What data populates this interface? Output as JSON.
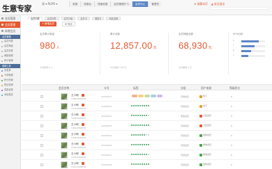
{
  "app": {
    "logo": "生意专家",
    "shop": "深 ▾ RLPO ▾"
  },
  "top_tabs": [
    {
      "label": "收银",
      "active": false
    },
    {
      "label": "收银台",
      "active": false
    },
    {
      "label": "快速收银",
      "active": false
    },
    {
      "label": "会员管理(F7)",
      "active": false
    },
    {
      "label": "会员中心",
      "active": true
    },
    {
      "label": "管理员",
      "active": false
    }
  ],
  "top_right": {
    "link1": "★ 收藏本页",
    "link2": "▲ 安全退出"
  },
  "sidebar": {
    "items": [
      {
        "label": "会员管理",
        "active": false
      },
      {
        "label": "会员管理",
        "active": true
      },
      {
        "label": "新增会员",
        "active": false
      }
    ],
    "sections": [
      {
        "title": "会员管理",
        "subs": [
          "会员列表",
          "会员等级",
          "会员标签",
          "储值管理",
          "积分管理"
        ]
      },
      {
        "title": "营销工具",
        "subs": [
          "优惠券",
          "卡项管理",
          "积分商城",
          "短信营销",
          "奖励设置",
          "消息推送"
        ]
      }
    ]
  },
  "subtabs": [
    {
      "label": "会员列表",
      "active": true
    },
    {
      "label": "会员标签",
      "active": false
    },
    {
      "label": "会员分组",
      "active": false
    },
    {
      "label": "会员卡",
      "active": false
    },
    {
      "label": "储值卡",
      "active": false
    },
    {
      "label": "商品设置",
      "active": false
    }
  ],
  "actions": {
    "add": "+ 新增会员",
    "filter": "▼ 筛选"
  },
  "stats": [
    {
      "label": "会员累计数量",
      "value": "980",
      "unit": "人",
      "sub": "今日新增 0 人"
    },
    {
      "label": "累计消费",
      "value": "12,857.00",
      "unit": "元",
      "sub": "今日消费 0.00 元"
    },
    {
      "label": "会员储值总额",
      "value": "68,930",
      "unit": "元",
      "sub": "今日储值 0 元"
    }
  ],
  "rfm": {
    "title": "RFM分析",
    "bars": [
      {
        "label": "R",
        "pct": 0.72
      },
      {
        "label": "F",
        "pct": 0.55
      },
      {
        "label": "M",
        "pct": 0.4
      },
      {
        "label": "V",
        "pct": 0.28
      }
    ]
  },
  "table": {
    "headers": [
      "会员名称",
      "卡号",
      "标签",
      "分组",
      "用户来源",
      "等级积分"
    ],
    "rows": [
      {
        "name": "王小明",
        "phone": "13812345678",
        "card": "00000001",
        "type": "tags",
        "group": "普通会员",
        "src": "线下",
        "src_color": "#e0a030",
        "pts": "0"
      },
      {
        "name": "王小明",
        "phone": "13712345678",
        "card": "00000002",
        "type": "stars",
        "stars": 5,
        "group": "普通会员",
        "src": "线下",
        "src_color": "#e0a030",
        "pts": "0"
      },
      {
        "name": "王小明",
        "phone": "13612345678",
        "card": "00000003",
        "type": "stars",
        "stars": 4,
        "group": "黄金会员",
        "src": "分店会员",
        "src_color": "#e5572f",
        "pts": "0"
      },
      {
        "name": "王小明",
        "phone": "13512345678",
        "card": "00000004",
        "type": "stars",
        "stars": 5,
        "group": "普通会员",
        "src": "分店会员",
        "src_color": "#e5572f",
        "pts": "0"
      },
      {
        "name": "王小明",
        "phone": "13412345678",
        "card": "00000005",
        "type": "stars",
        "stars": 3,
        "group": "普通会员",
        "src": "微信会员",
        "src_color": "#47a447",
        "pts": "0"
      },
      {
        "name": "王小明",
        "phone": "13312345678",
        "card": "00000006",
        "type": "stars",
        "stars": 5,
        "group": "普通会员",
        "src": "微信会员",
        "src_color": "#47a447",
        "pts": "0"
      },
      {
        "name": "王小明",
        "phone": "13212345678",
        "card": "00000007",
        "type": "stars",
        "stars": 4,
        "group": "普通会员",
        "src": "微信会员",
        "src_color": "#47a447",
        "pts": "0"
      },
      {
        "name": "王小明",
        "phone": "13112345678",
        "card": "00000008",
        "type": "stars",
        "stars": 5,
        "group": "普通会员",
        "src": "微信会员",
        "src_color": "#47a447",
        "pts": "0"
      }
    ],
    "tag_colors": [
      "#f3b48c",
      "#f7cf8a",
      "#c8dca0",
      "#a9cde8",
      "#d6b8e6"
    ]
  },
  "colors": {
    "accent": "#e5572f",
    "nav": "#4d6e97",
    "tab_active": "#5b86c5"
  }
}
